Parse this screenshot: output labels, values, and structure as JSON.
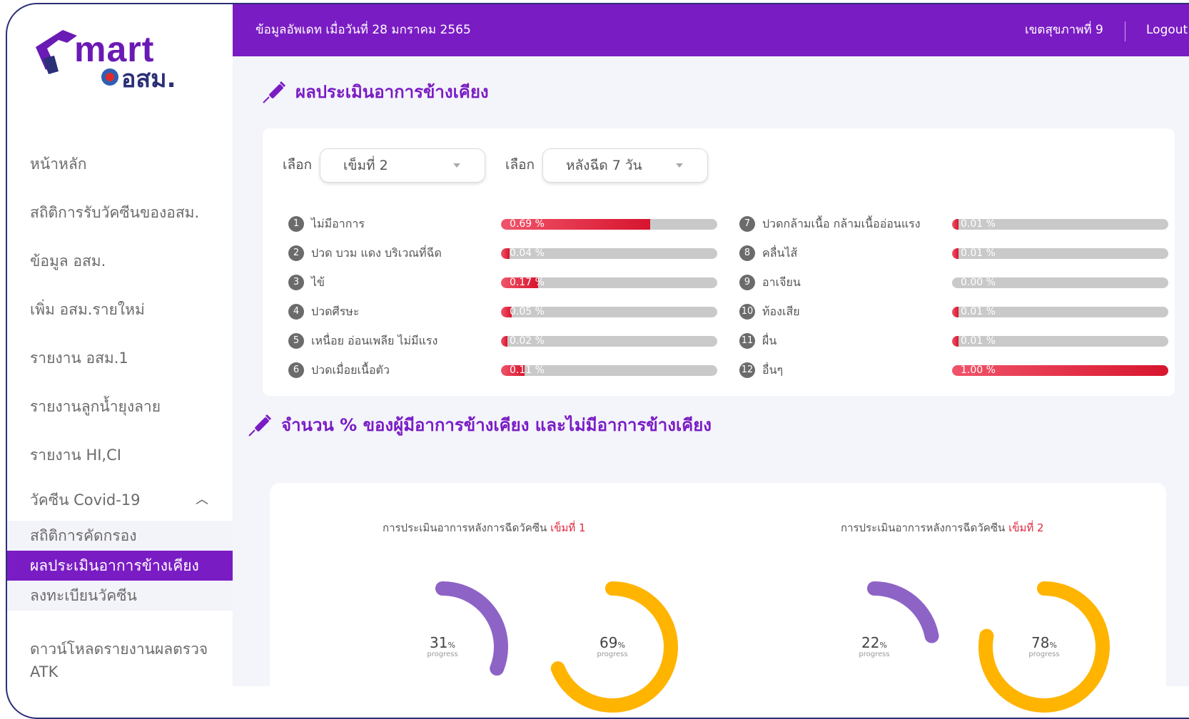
{
  "header": {
    "update_text": "ข้อมูลอัพเดท เมื่อวันที่ 28 มกราคม 2565",
    "region": "เขตสุขภาพที่ 9",
    "logout": "Logout"
  },
  "logo": {
    "word": "Smart",
    "sub": "อสม."
  },
  "sidebar": {
    "items": [
      {
        "label": "หน้าหลัก"
      },
      {
        "label": "สถิติการรับวัคซีนของอสม."
      },
      {
        "label": "ข้อมูล อสม."
      },
      {
        "label": "เพิ่ม อสม.รายใหม่"
      },
      {
        "label": "รายงาน อสม.1"
      },
      {
        "label": "รายงานลูกน้ำยุงลาย"
      },
      {
        "label": "รายงาน HI,CI"
      }
    ],
    "group": {
      "label": "วัคซีน Covid-19",
      "children": [
        {
          "label": "สถิติการคัดกรอง"
        },
        {
          "label": "ผลประเมินอาการข้างเคียง"
        },
        {
          "label": "ลงทะเบียนวัคซีน"
        }
      ]
    },
    "download": "ดาวน์โหลดรายงานผลตรวจ ATK"
  },
  "section1": {
    "title": "ผลประเมินอาการข้างเคียง",
    "filter1": {
      "label": "เลือก",
      "value": "เข็มที่ 2"
    },
    "filter2": {
      "label": "เลือก",
      "value": "หลังฉีด 7 วัน"
    },
    "symptoms": [
      {
        "n": "1",
        "label": "ไม่มีอาการ",
        "pct_text": "0.69 %",
        "fill": 0.69
      },
      {
        "n": "2",
        "label": "ปวด บวม แดง บริเวณที่ฉีด",
        "pct_text": "0.04 %",
        "fill": 0.04
      },
      {
        "n": "3",
        "label": "ไข้",
        "pct_text": "0.17 %",
        "fill": 0.17
      },
      {
        "n": "4",
        "label": "ปวดศีรษะ",
        "pct_text": "0.05 %",
        "fill": 0.05
      },
      {
        "n": "5",
        "label": "เหนื่อย อ่อนเพลีย ไม่มีแรง",
        "pct_text": "0.02 %",
        "fill": 0.02
      },
      {
        "n": "6",
        "label": "ปวดเมื่อยเนื้อตัว",
        "pct_text": "0.11 %",
        "fill": 0.11
      },
      {
        "n": "7",
        "label": "ปวดกล้ามเนื้อ กล้ามเนื้ออ่อนแรง",
        "pct_text": "0.01 %",
        "fill": 0.01
      },
      {
        "n": "8",
        "label": "คลื่นไส้",
        "pct_text": "0.01 %",
        "fill": 0.01
      },
      {
        "n": "9",
        "label": "อาเจียน",
        "pct_text": "0.00 %",
        "fill": 0.0
      },
      {
        "n": "10",
        "label": "ท้องเสีย",
        "pct_text": "0.01 %",
        "fill": 0.01
      },
      {
        "n": "11",
        "label": "ผื่น",
        "pct_text": "0.01 %",
        "fill": 0.01
      },
      {
        "n": "12",
        "label": "อื่นๆ",
        "pct_text": "1.00 %",
        "fill": 1.0
      }
    ]
  },
  "section2": {
    "title": "จำนวน % ของผู้มีอาการข้างเคียง และไม่มีอาการข้างเคียง",
    "dose1": {
      "title": "การประเมินอาการหลังการฉีดวัคซีน",
      "highlight": "เข็มที่ 1",
      "a": {
        "value": "31",
        "pct": 31,
        "unit": "%",
        "caption": "progress",
        "color": "#8e63c6"
      },
      "b": {
        "value": "69",
        "pct": 69,
        "unit": "%",
        "caption": "progress",
        "color": "#ffb400"
      }
    },
    "dose2": {
      "title": "การประเมินอาการหลังการฉีดวัคซีน",
      "highlight": "เข็มที่ 2",
      "a": {
        "value": "22",
        "pct": 22,
        "unit": "%",
        "caption": "progress",
        "color": "#8e63c6"
      },
      "b": {
        "value": "78",
        "pct": 78,
        "unit": "%",
        "caption": "progress",
        "color": "#ffb400"
      }
    }
  },
  "colors": {
    "primary": "#7a1cc4",
    "bar_fill": "#e0283e",
    "bar_track": "#c9c9c9"
  }
}
